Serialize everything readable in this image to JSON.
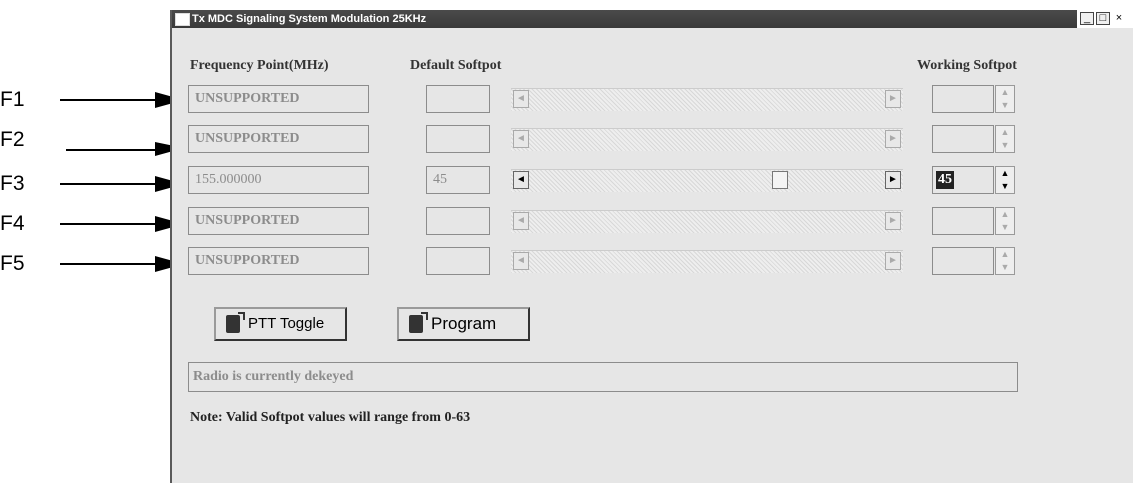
{
  "callouts": [
    "F1",
    "F2",
    "F3",
    "F4",
    "F5"
  ],
  "window": {
    "title": "Tx MDC Signaling System Modulation 25KHz",
    "controls": {
      "minimize": "_",
      "maximize": "□",
      "close": "×"
    }
  },
  "headers": {
    "frequency": "Frequency Point(MHz)",
    "default": "Default Softpot",
    "working": "Working Softpot"
  },
  "rows": [
    {
      "frequency": "UNSUPPORTED",
      "default": "",
      "working": "",
      "slider_value": null
    },
    {
      "frequency": "UNSUPPORTED",
      "default": "",
      "working": "",
      "slider_value": null
    },
    {
      "frequency": "155.000000",
      "default": "45",
      "working": "45",
      "slider_value": 45,
      "slider_max": 63
    },
    {
      "frequency": "UNSUPPORTED",
      "default": "",
      "working": "",
      "slider_value": null
    },
    {
      "frequency": "UNSUPPORTED",
      "default": "",
      "working": "",
      "slider_value": null
    }
  ],
  "buttons": {
    "ptt": "PTT Toggle",
    "program": "Program"
  },
  "status": "Radio is currently dekeyed",
  "note": "Note: Valid Softpot values will range from 0-63"
}
